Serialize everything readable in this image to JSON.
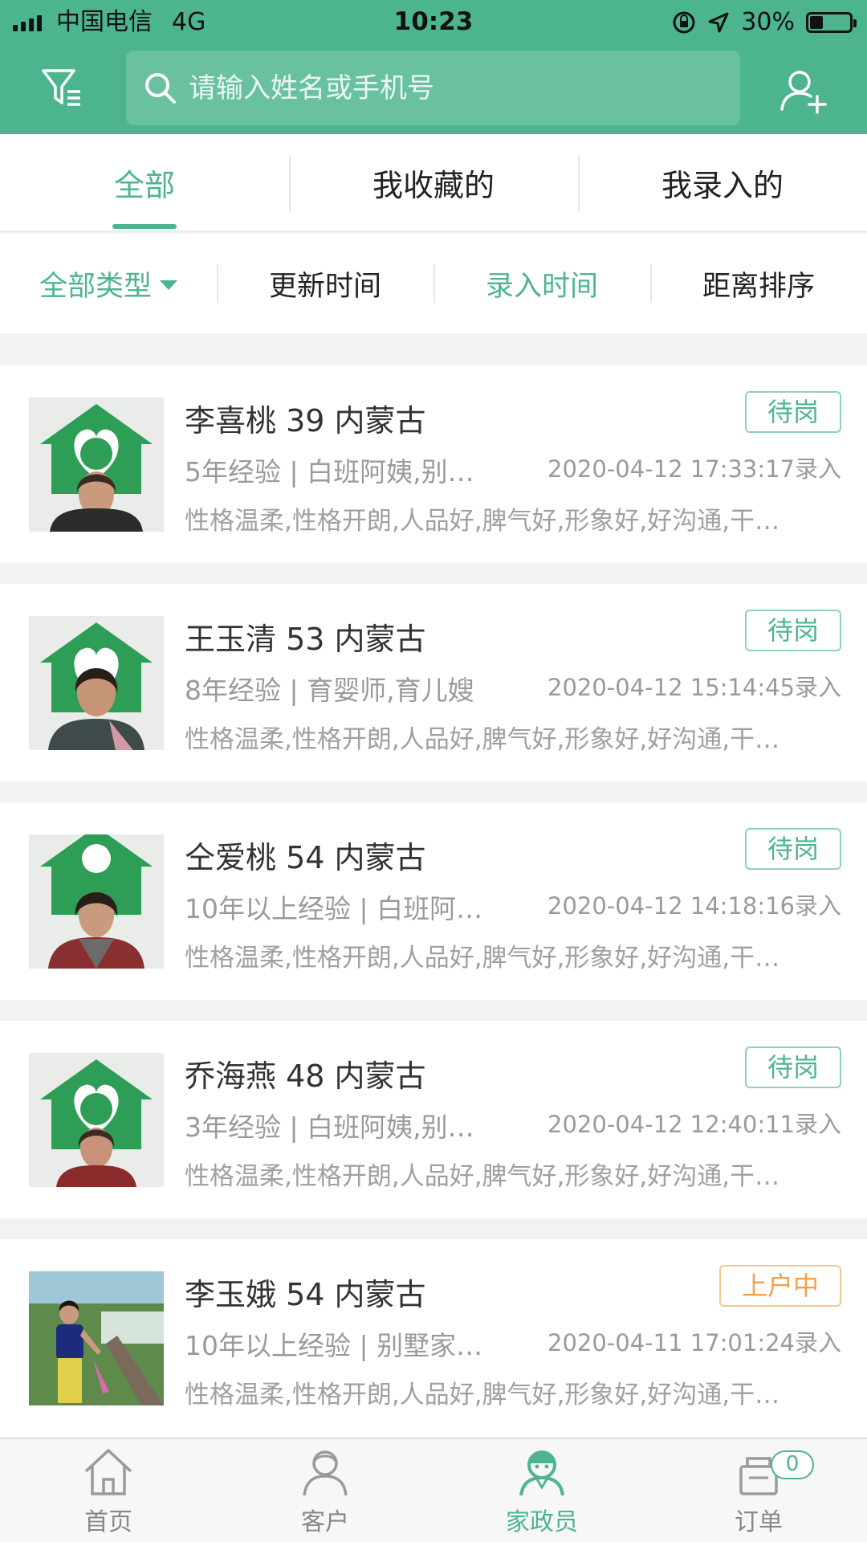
{
  "status_bar": {
    "carrier": "中国电信",
    "network": "4G",
    "time": "10:23",
    "battery": "30%",
    "battery_level": 0.3
  },
  "header": {
    "filter_icon": "filter-icon",
    "search_placeholder": "请输入姓名或手机号",
    "add_user_icon": "add-user-icon"
  },
  "tabs": [
    {
      "label": "全部",
      "active": true
    },
    {
      "label": "我收藏的",
      "active": false
    },
    {
      "label": "我录入的",
      "active": false
    }
  ],
  "sort": [
    {
      "label": "全部类型",
      "highlight": true
    },
    {
      "label": "更新时间",
      "highlight": false
    },
    {
      "label": "录入时间",
      "highlight": true
    },
    {
      "label": "距离排序",
      "highlight": false
    }
  ],
  "workers": [
    {
      "name_line": "李喜桃 39 内蒙古",
      "status": "待岗",
      "experience": "5年经验 | 白班阿姨,别…",
      "time": "2020-04-12 17:33:17录入",
      "tags": "性格温柔,性格开朗,人品好,脾气好,形象好,好沟通,干…"
    },
    {
      "name_line": "王玉清 53 内蒙古",
      "status": "待岗",
      "experience": "8年经验 | 育婴师,育儿嫂",
      "time": "2020-04-12 15:14:45录入",
      "tags": "性格温柔,性格开朗,人品好,脾气好,形象好,好沟通,干…"
    },
    {
      "name_line": "仝爱桃 54 内蒙古",
      "status": "待岗",
      "experience": "10年以上经验 | 白班阿…",
      "time": "2020-04-12 14:18:16录入",
      "tags": "性格温柔,性格开朗,人品好,脾气好,形象好,好沟通,干…"
    },
    {
      "name_line": "乔海燕 48 内蒙古",
      "status": "待岗",
      "experience": "3年经验 | 白班阿姨,别…",
      "time": "2020-04-12 12:40:11录入",
      "tags": "性格温柔,性格开朗,人品好,脾气好,形象好,好沟通,干…"
    },
    {
      "name_line": "李玉娥 54 内蒙古",
      "status": "上户中",
      "experience": "10年以上经验 | 别墅家…",
      "time": "2020-04-11 17:01:24录入",
      "tags": "性格温柔,性格开朗,人品好,脾气好,形象好,好沟通,干…"
    }
  ],
  "bottom_nav": [
    {
      "label": "首页",
      "icon": "home-icon"
    },
    {
      "label": "客户",
      "icon": "customer-icon"
    },
    {
      "label": "家政员",
      "icon": "worker-icon",
      "active": true
    },
    {
      "label": "订单",
      "icon": "order-icon",
      "badge": "0"
    }
  ],
  "colors": {
    "brand": "#4db58e",
    "badge_orange": "#f0a24a"
  }
}
